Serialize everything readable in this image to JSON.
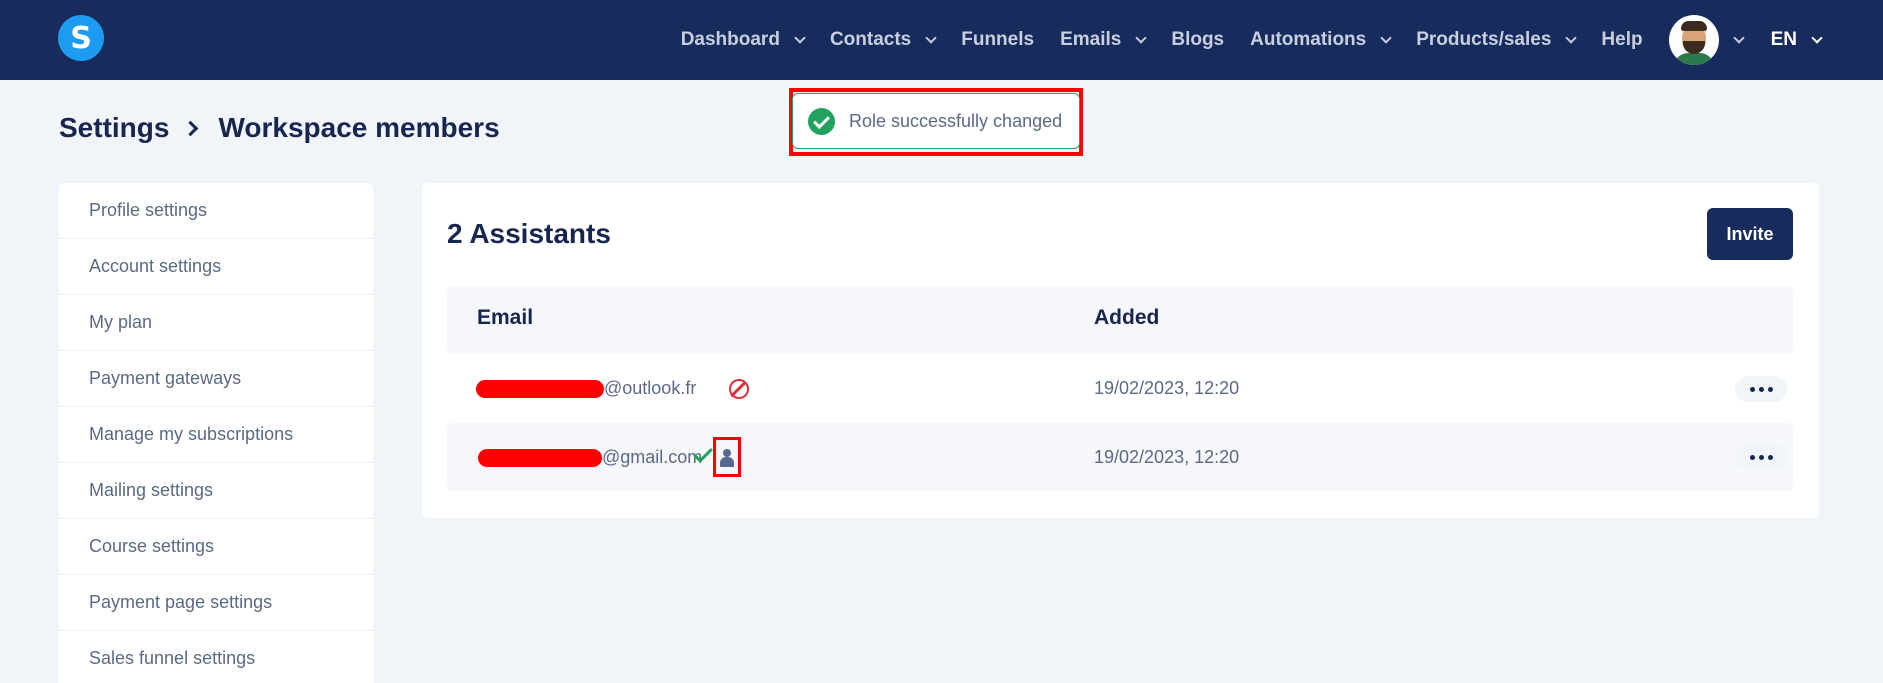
{
  "header": {
    "logo_letter": "S",
    "nav": [
      {
        "label": "Dashboard",
        "dropdown": true
      },
      {
        "label": "Contacts",
        "dropdown": true
      },
      {
        "label": "Funnels",
        "dropdown": false
      },
      {
        "label": "Emails",
        "dropdown": true
      },
      {
        "label": "Blogs",
        "dropdown": false
      },
      {
        "label": "Automations",
        "dropdown": true
      },
      {
        "label": "Products/sales",
        "dropdown": true
      },
      {
        "label": "Help",
        "dropdown": false
      }
    ],
    "language": "EN"
  },
  "toast": {
    "message": "Role successfully changed",
    "icon": "check-circle-icon",
    "color": "#21a35f"
  },
  "breadcrumb": {
    "root": "Settings",
    "current": "Workspace members"
  },
  "sidebar": {
    "items": [
      {
        "label": "Profile settings"
      },
      {
        "label": "Account settings"
      },
      {
        "label": "My plan"
      },
      {
        "label": "Payment gateways"
      },
      {
        "label": "Manage my subscriptions"
      },
      {
        "label": "Mailing settings"
      },
      {
        "label": "Course settings"
      },
      {
        "label": "Payment page settings"
      },
      {
        "label": "Sales funnel settings"
      }
    ]
  },
  "members": {
    "title": "2 Assistants",
    "invite_label": "Invite",
    "columns": {
      "email": "Email",
      "added": "Added"
    },
    "rows": [
      {
        "email_suffix": "@outlook.fr",
        "status_icon": "ban-icon",
        "added": "19/02/2023, 12:20"
      },
      {
        "email_suffix": "@gmail.com",
        "status_icon": "check-icon",
        "role_icon": "user-icon",
        "added": "19/02/2023, 12:20"
      }
    ]
  },
  "colors": {
    "navbar": "#172b5d",
    "accent": "#1c9bf0",
    "highlight": "#ff0000",
    "success": "#21a35f",
    "danger": "#e0303a"
  }
}
